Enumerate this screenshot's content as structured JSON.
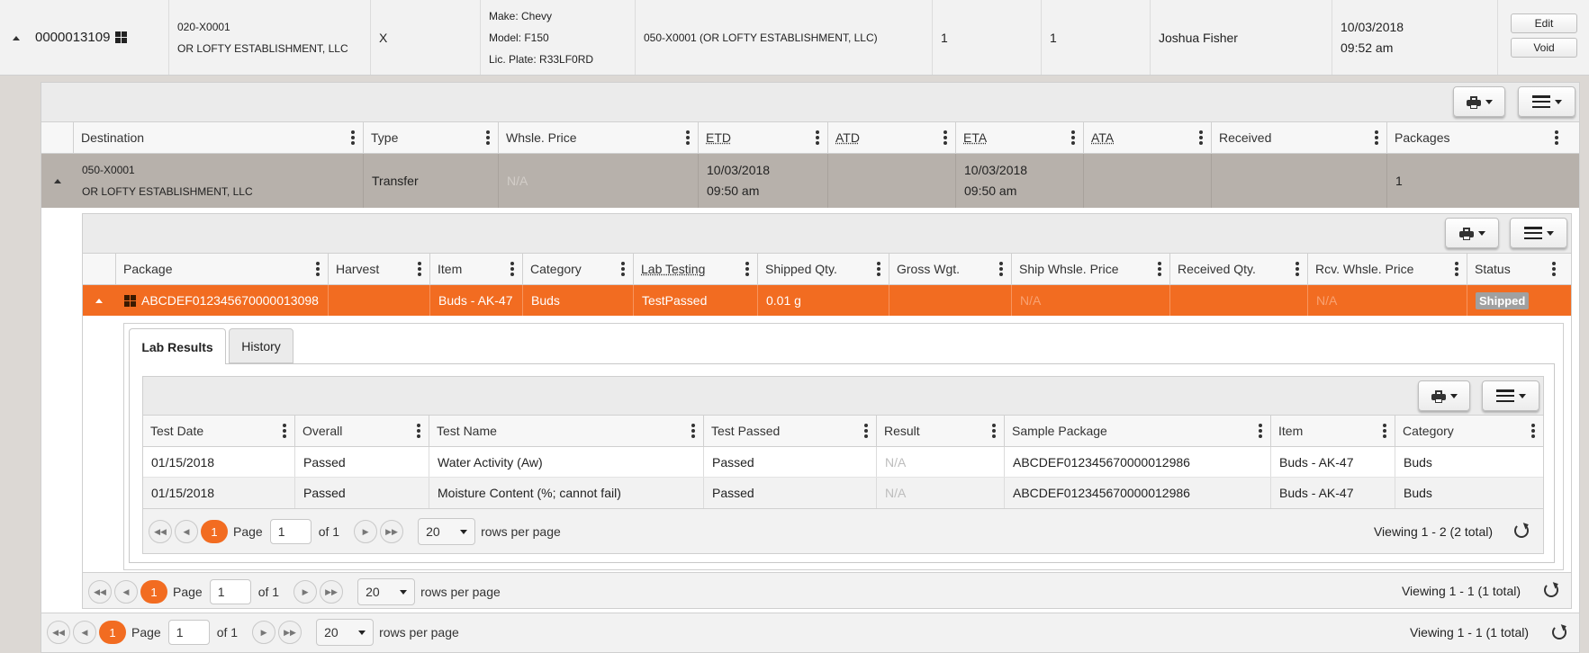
{
  "top_row": {
    "manifest": "0000013109",
    "shipper_line1": "020-X0001",
    "shipper_line2": "OR LOFTY ESTABLISHMENT, LLC",
    "type_code": "X",
    "vehicle_make": "Make: Chevy",
    "vehicle_model": "Model: F150",
    "vehicle_plate": "Lic. Plate: R33LF0RD",
    "destination": "050-X0001 (OR LOFTY ESTABLISHMENT, LLC)",
    "count1": "1",
    "count2": "1",
    "driver": "Joshua Fisher",
    "date": "10/03/2018",
    "time": "09:52 am",
    "edit_label": "Edit",
    "void_label": "Void"
  },
  "dest_table": {
    "headers": [
      "Destination",
      "Type",
      "Whsle. Price",
      "ETD",
      "ATD",
      "ETA",
      "ATA",
      "Received",
      "Packages"
    ],
    "row": {
      "dest_line1": "050-X0001",
      "dest_line2": "OR LOFTY ESTABLISHMENT, LLC",
      "type": "Transfer",
      "whsle_price": "N/A",
      "etd_date": "10/03/2018",
      "etd_time": "09:50 am",
      "atd": "",
      "eta_date": "10/03/2018",
      "eta_time": "09:50 am",
      "ata": "",
      "received": "",
      "packages": "1"
    },
    "pager": {
      "page": "1",
      "page_label": "Page",
      "of_label": "of 1",
      "rows": "20",
      "rows_label": "rows per page",
      "viewing": "Viewing 1 - 1 (1 total)"
    }
  },
  "package_table": {
    "headers": [
      "Package",
      "Harvest",
      "Item",
      "Category",
      "Lab Testing",
      "Shipped Qty.",
      "Gross Wgt.",
      "Ship Whsle. Price",
      "Received Qty.",
      "Rcv. Whsle. Price",
      "Status"
    ],
    "row": {
      "package": "ABCDEF012345670000013098",
      "harvest": "",
      "item": "Buds - AK-47",
      "category": "Buds",
      "lab_testing": "TestPassed",
      "shipped_qty": "0.01 g",
      "gross_wgt": "",
      "ship_price": "N/A",
      "received_qty": "",
      "rcv_price": "N/A",
      "status": "Shipped"
    },
    "pager": {
      "page": "1",
      "page_label": "Page",
      "of_label": "of 1",
      "rows": "20",
      "rows_label": "rows per page",
      "viewing": "Viewing 1 - 1 (1 total)"
    }
  },
  "tabs": {
    "lab_results": "Lab Results",
    "history": "History"
  },
  "lab_table": {
    "headers": [
      "Test Date",
      "Overall",
      "Test Name",
      "Test Passed",
      "Result",
      "Sample Package",
      "Item",
      "Category"
    ],
    "rows": [
      {
        "date": "01/15/2018",
        "overall": "Passed",
        "name": "Water Activity (Aw)",
        "passed": "Passed",
        "result": "N/A",
        "sample": "ABCDEF012345670000012986",
        "item": "Buds - AK-47",
        "category": "Buds"
      },
      {
        "date": "01/15/2018",
        "overall": "Passed",
        "name": "Moisture Content (%; cannot fail)",
        "passed": "Passed",
        "result": "N/A",
        "sample": "ABCDEF012345670000012986",
        "item": "Buds - AK-47",
        "category": "Buds"
      }
    ],
    "pager": {
      "page": "1",
      "page_label": "Page",
      "of_label": "of 1",
      "rows": "20",
      "rows_label": "rows per page",
      "viewing": "Viewing 1 - 2 (2 total)"
    }
  },
  "colors": {
    "accent": "#f26c21",
    "status_badge": "#a0a0a0",
    "selected_row": "#b7b1ab"
  }
}
